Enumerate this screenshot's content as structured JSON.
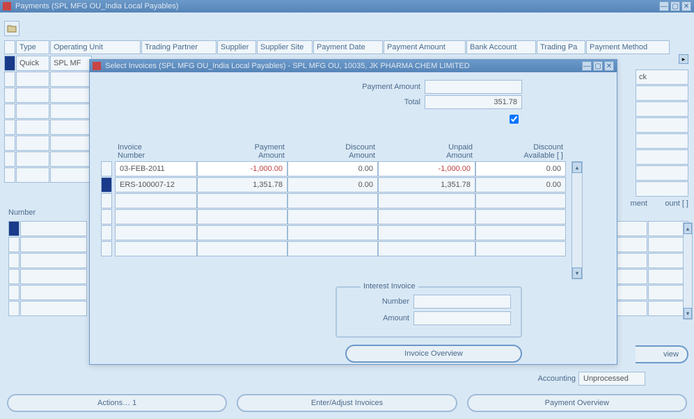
{
  "parent_window": {
    "title": "Payments (SPL MFG OU_India Local Payables)",
    "columns": [
      "Type",
      "Operating Unit",
      "Trading Partner",
      "Supplier",
      "Supplier Site",
      "Payment Date",
      "Payment Amount",
      "Bank Account",
      "Trading Pa",
      "Payment Method"
    ],
    "row0": {
      "type": "Quick",
      "ou": "SPL MF",
      "pm": "ck"
    },
    "number_label": "Number",
    "sub_headers": {
      "ment": "ment",
      "ount": "ount  [  ]"
    },
    "accounting_label": "Accounting",
    "accounting_value": "Unprocessed",
    "buttons": {
      "actions": "Actions… 1",
      "enter": "Enter/Adjust Invoices",
      "payment_overview": "Payment Overview"
    },
    "side_view": "view"
  },
  "modal": {
    "title": "Select Invoices (SPL MFG OU_India Local Payables) - SPL MFG OU, 10035, JK PHARMA CHEM LIMITED",
    "payment_amount_label": "Payment Amount",
    "payment_amount_value": "",
    "total_label": "Total",
    "total_value": "351.78",
    "col_headers": {
      "invoice_number_1": "Invoice",
      "invoice_number_2": "Number",
      "payment_amount_1": "Payment",
      "payment_amount_2": "Amount",
      "discount_amount_1": "Discount",
      "discount_amount_2": "Amount",
      "unpaid_amount_1": "Unpaid",
      "unpaid_amount_2": "Amount",
      "discount_avail_1": "Discount",
      "discount_avail_2": "Available  [  ]"
    },
    "rows": [
      {
        "selected": false,
        "invoice": "03-FEB-2011",
        "payment": "-1,000.00",
        "discount": "0.00",
        "unpaid": "-1,000.00",
        "avail": "0.00",
        "neg": true,
        "white": true
      },
      {
        "selected": true,
        "invoice": "ERS-100007-12",
        "payment": "1,351.78",
        "discount": "0.00",
        "unpaid": "1,351.78",
        "avail": "0.00",
        "neg": false,
        "white": false
      }
    ],
    "interest": {
      "legend": "Interest Invoice",
      "number_label": "Number",
      "amount_label": "Amount"
    },
    "invoice_overview": "Invoice Overview"
  }
}
